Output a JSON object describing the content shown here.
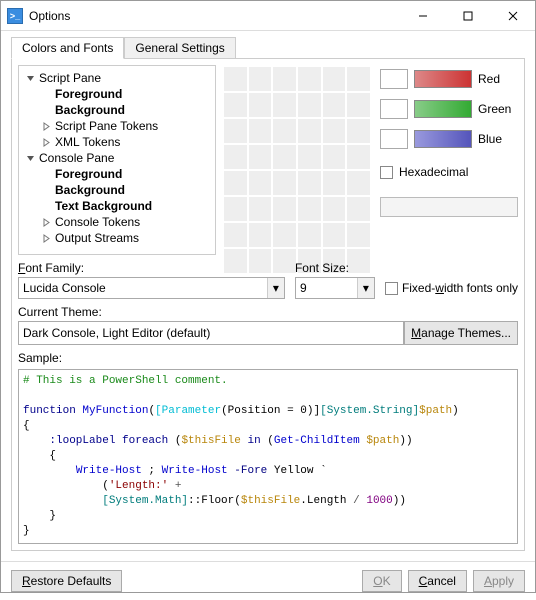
{
  "window": {
    "title": "Options"
  },
  "tabs": {
    "colors": "Colors and Fonts",
    "general": "General Settings"
  },
  "tree": [
    {
      "label": "Script Pane",
      "level": 1,
      "bold": false,
      "exp": "open"
    },
    {
      "label": "Foreground",
      "level": 2,
      "bold": true,
      "exp": ""
    },
    {
      "label": "Background",
      "level": 2,
      "bold": true,
      "exp": ""
    },
    {
      "label": "Script Pane Tokens",
      "level": 2,
      "bold": false,
      "exp": "closed"
    },
    {
      "label": "XML Tokens",
      "level": 2,
      "bold": false,
      "exp": "closed"
    },
    {
      "label": "Console Pane",
      "level": 1,
      "bold": false,
      "exp": "open"
    },
    {
      "label": "Foreground",
      "level": 2,
      "bold": true,
      "exp": ""
    },
    {
      "label": "Background",
      "level": 2,
      "bold": true,
      "exp": ""
    },
    {
      "label": "Text Background",
      "level": 2,
      "bold": true,
      "exp": ""
    },
    {
      "label": "Console Tokens",
      "level": 2,
      "bold": false,
      "exp": "closed"
    },
    {
      "label": "Output Streams",
      "level": 2,
      "bold": false,
      "exp": "closed"
    }
  ],
  "sliders": {
    "red": "Red",
    "green": "Green",
    "blue": "Blue",
    "hex": "Hexadecimal"
  },
  "fontFamily": {
    "label": "Font Family:",
    "value": "Lucida Console"
  },
  "fontSize": {
    "label": "Font Size:",
    "value": "9"
  },
  "fixedWidth": "Fixed-width fonts only",
  "theme": {
    "label": "Current Theme:",
    "value": "Dark Console, Light Editor (default)",
    "manage": "Manage Themes..."
  },
  "sampleLabel": "Sample:",
  "sample": {
    "l1": "# This is a PowerShell comment.",
    "fn_kw": "function",
    "fn_name": "MyFunction",
    "param_attr": "[Parameter",
    "param_inner": "Position = 0",
    "type": "[System.String]",
    "var_path": "$path",
    "loop_lbl": ":loopLabel",
    "foreach": "foreach",
    "var_file": "$thisFile",
    "in": "in",
    "gci": "Get-ChildItem",
    "wh": "Write-Host",
    "fore": "-Fore",
    "yellow": "Yellow",
    "str_len": "'Length:'",
    "plus": "+",
    "type_math": "[System.Math]",
    "floor": "::Floor",
    "len_prop": ".Length",
    "div": "/",
    "thousand": "1000"
  },
  "footer": {
    "restore": "Restore Defaults",
    "ok": "OK",
    "cancel": "Cancel",
    "apply": "Apply"
  }
}
